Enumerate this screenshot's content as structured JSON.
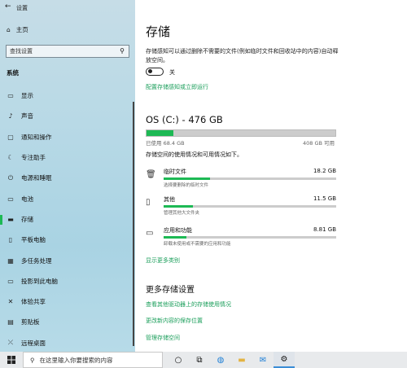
{
  "window": {
    "title": "设置"
  },
  "sidebar": {
    "home_label": "主页",
    "search_placeholder": "查找设置",
    "section_title": "系统",
    "items": [
      {
        "label": "显示",
        "icon": "monitor-icon"
      },
      {
        "label": "声音",
        "icon": "speaker-icon"
      },
      {
        "label": "通知和操作",
        "icon": "notification-icon"
      },
      {
        "label": "专注助手",
        "icon": "moon-icon"
      },
      {
        "label": "电源和睡眠",
        "icon": "power-icon"
      },
      {
        "label": "电池",
        "icon": "battery-icon"
      },
      {
        "label": "存储",
        "icon": "storage-icon",
        "active": true
      },
      {
        "label": "平板电脑",
        "icon": "tablet-icon"
      },
      {
        "label": "多任务处理",
        "icon": "multitask-icon"
      },
      {
        "label": "投影到此电脑",
        "icon": "project-icon"
      },
      {
        "label": "体验共享",
        "icon": "share-icon"
      },
      {
        "label": "剪贴板",
        "icon": "clipboard-icon"
      },
      {
        "label": "远程桌面",
        "icon": "remote-icon"
      }
    ]
  },
  "main": {
    "title": "存储",
    "description": "存储感知可以通过删除不需要的文件(例如临时文件和回收站中的内容)自动释放空间。",
    "toggle_state": "关",
    "configure_link": "配置存储感知或立即运行",
    "drive": {
      "title": "OS (C:) - 476 GB",
      "used_fraction": 0.144,
      "used_label": "已使用 68.4 GB",
      "free_label": "408 GB 可用",
      "usage_desc": "存储空间的使用情况和可用情况如下。"
    },
    "categories": [
      {
        "name": "临时文件",
        "size": "18.2 GB",
        "sub": "选择要删除的临时文件",
        "fraction": 0.27,
        "icon": "trash-icon"
      },
      {
        "name": "其他",
        "size": "11.5 GB",
        "sub": "管理其他大文件夹",
        "fraction": 0.17,
        "icon": "file-icon"
      },
      {
        "name": "应用和功能",
        "size": "8.81 GB",
        "sub": "卸载未使用或不需要的应用和功能",
        "fraction": 0.13,
        "icon": "apps-icon"
      }
    ],
    "show_more_link": "显示更多类别",
    "more_settings_title": "更多存储设置",
    "more_links": [
      "查看其他驱动器上的存储使用情况",
      "更改新内容的保存位置",
      "管理存储空间"
    ]
  },
  "taskbar": {
    "search_placeholder": "在这里输入你要搜索的内容"
  }
}
